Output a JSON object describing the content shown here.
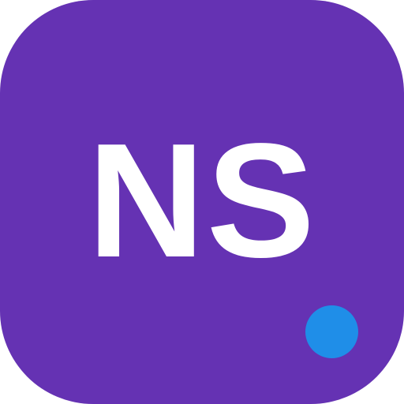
{
  "icon": {
    "monogram": "NS",
    "background_color": "#6532b3",
    "text_color": "#ffffff"
  },
  "status_indicator": {
    "color": "#1f8ee8",
    "icon": "status-dot-icon"
  }
}
